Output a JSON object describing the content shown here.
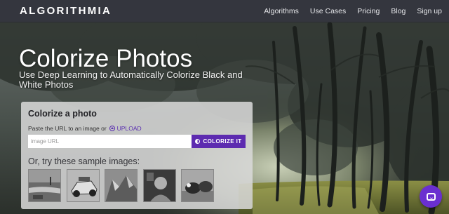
{
  "navbar": {
    "logo": "ALGORITHMIA",
    "links": [
      "Algorithms",
      "Use Cases",
      "Pricing",
      "Blog",
      "Sign up"
    ]
  },
  "hero": {
    "title": "Colorize Photos",
    "subtitle": "Use Deep Learning to Automatically Colorize Black and White Photos"
  },
  "panel": {
    "title": "Colorize a photo",
    "hint": "Paste the URL to an image or",
    "upload_label": "UPLOAD",
    "url_placeholder": "image URL",
    "button_label": "COLORIZE IT",
    "samples_title": "Or, try these sample images:",
    "samples": [
      {
        "icon": "river-landscape"
      },
      {
        "icon": "race-car"
      },
      {
        "icon": "rock-formation"
      },
      {
        "icon": "portrait"
      },
      {
        "icon": "cows"
      }
    ]
  },
  "chat": {
    "icon": "chat-icon"
  },
  "colors": {
    "navbar": "#34363e",
    "accent": "#5d2bb0",
    "chat": "#6a2fd0"
  }
}
